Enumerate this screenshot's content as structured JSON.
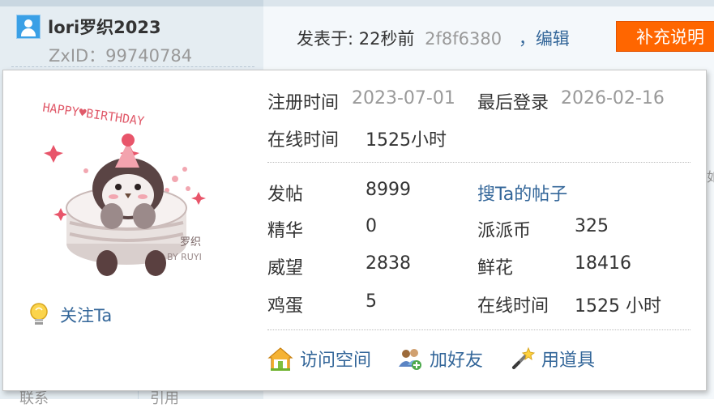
{
  "author": {
    "name": "lori罗织2023",
    "zxid": "ZxID：99740784"
  },
  "post": {
    "posted_at": "发表于: 22秒前",
    "hash": "2f8f6380",
    "separator": "，",
    "edit_label": "编辑",
    "supplement_label": "补充说明"
  },
  "background": {
    "bottom_left": "联系",
    "bottom_mid": "引用",
    "right_edge": "如"
  },
  "popup": {
    "avatar": {
      "text_top": "HAPPY♥BIRTHDAY",
      "text_sign": "罗织",
      "text_by": "BY RUYI"
    },
    "follow_label": "关注Ta",
    "registered_label": "注册时间",
    "registered_value": "2023-07-01",
    "last_login_label": "最后登录",
    "last_login_value": "2026-02-16",
    "online_label": "在线时间",
    "online_value": "1525小时",
    "search_posts_label": "搜Ta的帖子",
    "stats_left": [
      {
        "label": "发帖",
        "value": "8999"
      },
      {
        "label": "精华",
        "value": "0"
      },
      {
        "label": "威望",
        "value": "2838"
      },
      {
        "label": "鸡蛋",
        "value": "5"
      }
    ],
    "stats_right": [
      {
        "label": "派派币",
        "value": "325"
      },
      {
        "label": "鲜花",
        "value": "18416"
      },
      {
        "label": "在线时间",
        "value": "1525 小时"
      }
    ],
    "actions": [
      {
        "label": "访问空间",
        "icon": "home-icon"
      },
      {
        "label": "加好友",
        "icon": "add-friend-icon"
      },
      {
        "label": "用道具",
        "icon": "magic-wand-icon"
      }
    ]
  },
  "colors": {
    "link": "#336699",
    "accent_orange": "#ff6600",
    "muted": "#999999"
  }
}
